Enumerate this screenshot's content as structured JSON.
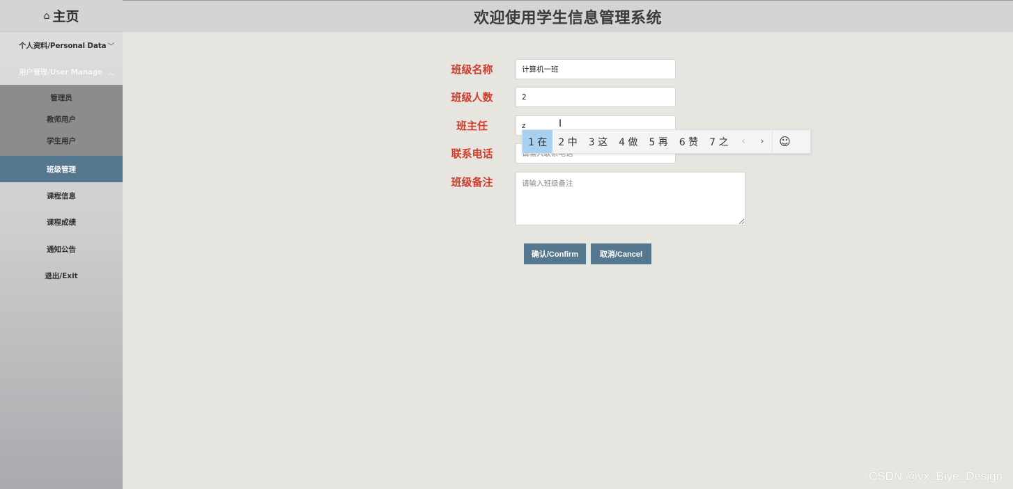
{
  "sidebar": {
    "home_icon": "⌂",
    "home_label": "主页",
    "menus": [
      {
        "label": "个人资料/Personal Data",
        "chevron": "﹀"
      },
      {
        "label": "用户管理/User Manage",
        "chevron": "︿"
      }
    ],
    "sub_items": [
      "管理员",
      "教师用户",
      "学生用户"
    ],
    "items": [
      "班级管理",
      "课程信息",
      "课程成绩",
      "通知公告",
      "退出/Exit"
    ]
  },
  "header": {
    "title": "欢迎使用学生信息管理系统"
  },
  "form": {
    "fields": [
      {
        "label": "班级名称",
        "value": "计算机一班",
        "placeholder": ""
      },
      {
        "label": "班级人数",
        "value": "2",
        "placeholder": ""
      },
      {
        "label": "班主任",
        "value": "z",
        "placeholder": ""
      },
      {
        "label": "联系电话",
        "value": "",
        "placeholder": "请输入联系电话"
      },
      {
        "label": "班级备注",
        "value": "",
        "placeholder": "请输入班级备注"
      }
    ],
    "confirm_label": "确认/Confirm",
    "cancel_label": "取消/Cancel"
  },
  "ime": {
    "candidates": [
      "1 在",
      "2 中",
      "3 这",
      "4 做",
      "5 再",
      "6 赞",
      "7 之"
    ],
    "prev": "‹",
    "next": "›",
    "emoji": "☺"
  },
  "watermark": "CSDN @vx_Biye_Design",
  "colors": {
    "accent": "#567790",
    "label": "#cf3d2d",
    "active_item": "#56788f"
  }
}
